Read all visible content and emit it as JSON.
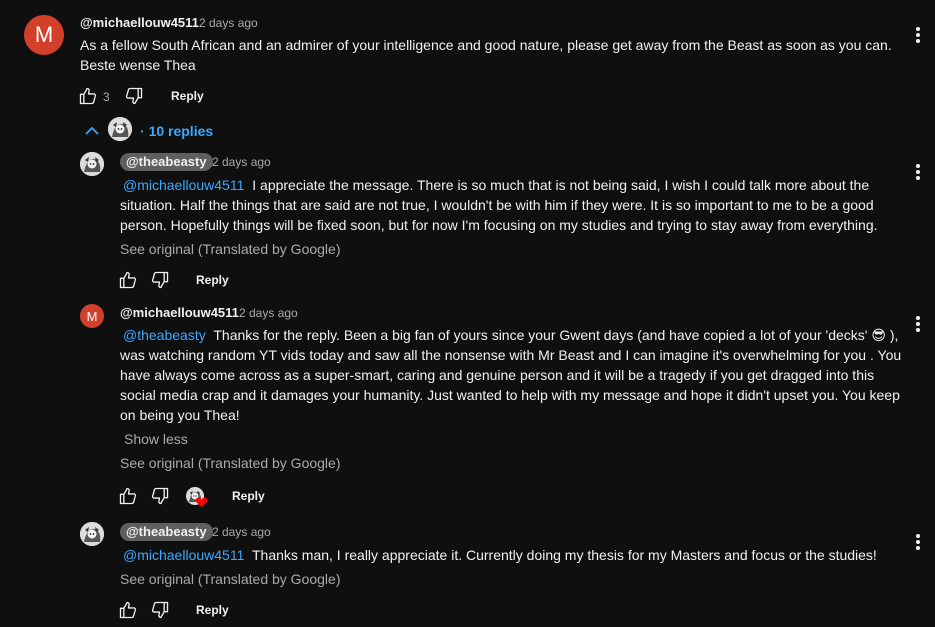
{
  "top_comment": {
    "avatar_letter": "M",
    "author": "@michaellouw4511",
    "time": "2 days ago",
    "text_line1": "As a fellow South African and an admirer of your intelligence and good nature, please get away from the Beast as soon as you can.",
    "text_line2": "Beste wense Thea",
    "likes": "3",
    "reply_label": "Reply"
  },
  "replies_toggle": {
    "label": "10 replies"
  },
  "replies": [
    {
      "author": "@theabeasty",
      "time": "2 days ago",
      "mention": "@michaellouw4511",
      "lines": [
        " I appreciate the message. There is so much that is not being said, I wish I could talk more about the",
        "situation. Half the things that are said are not true, I wouldn't be with him if they were. It is so important to me to be a good",
        "person. Hopefully things will be fixed soon, but for now I'm focusing on my studies and trying to stay away from everything."
      ],
      "see_original": "See original (Translated by Google)",
      "reply_label": "Reply"
    },
    {
      "avatar_letter": "M",
      "author": "@michaellouw4511",
      "time": "2 days ago",
      "mention": "@theabeasty",
      "lines": [
        " Thanks for the reply. Been a big fan of yours since your Gwent days (and have copied a lot of your 'decks' 😎 ),",
        "was watching random YT vids today and saw all the nonsense with Mr Beast and I can imagine it's overwhelming for you . You",
        "have always come across as a super-smart, caring and genuine person and it will be a tragedy if you get dragged into this",
        "social media crap and it damages your humanity. Just wanted to help with my message and hope it didn't upset you. You keep",
        "on being you Thea!"
      ],
      "show_less": "Show less",
      "see_original": "See original (Translated by Google)",
      "reply_label": "Reply"
    },
    {
      "author": "@theabeasty",
      "time": "2 days ago",
      "mention": "@michaellouw4511",
      "lines": [
        " Thanks man, I really appreciate it. Currently doing my thesis for my Masters and focus or the studies!"
      ],
      "see_original": "See original (Translated by Google)",
      "reply_label": "Reply"
    }
  ],
  "colors": {
    "background": "#0f0f0f",
    "text": "#f1f1f1",
    "secondary_text": "#aaaaaa",
    "link_blue": "#3ea6ff",
    "avatar_red": "#d23f2a",
    "creator_chip": "#5f5f5f",
    "heart_red": "#ff0000"
  },
  "icons": [
    "thumb-up-icon",
    "thumb-down-icon",
    "more-vert-icon",
    "chevron-up-icon",
    "creator-heart-icon",
    "channel-avatar"
  ]
}
